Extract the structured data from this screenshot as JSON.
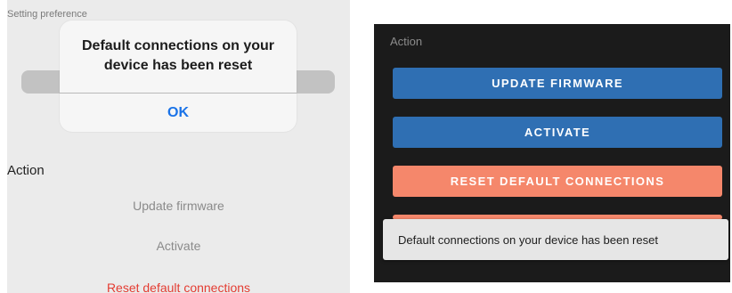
{
  "left_panel": {
    "section_label": "Setting preference",
    "alert": {
      "message": "Default connections on your device has been reset",
      "ok_label": "OK"
    },
    "action_title": "Action",
    "actions": [
      {
        "label": "Update firmware"
      },
      {
        "label": "Activate"
      },
      {
        "label": "Reset default connections"
      }
    ]
  },
  "right_panel": {
    "action_title": "Action",
    "buttons": [
      {
        "label": "UPDATE FIRMWARE",
        "color": "#2f6fb3"
      },
      {
        "label": "ACTIVATE",
        "color": "#2f6fb3"
      },
      {
        "label": "RESET DEFAULT CONNECTIONS",
        "color": "#f5876b"
      }
    ],
    "toast": {
      "message": "Default connections on your device has been reset"
    }
  },
  "colors": {
    "ios_blue": "#1a73e8",
    "destructive_red": "#e43c32",
    "dark_bg": "#1b1b1b"
  }
}
